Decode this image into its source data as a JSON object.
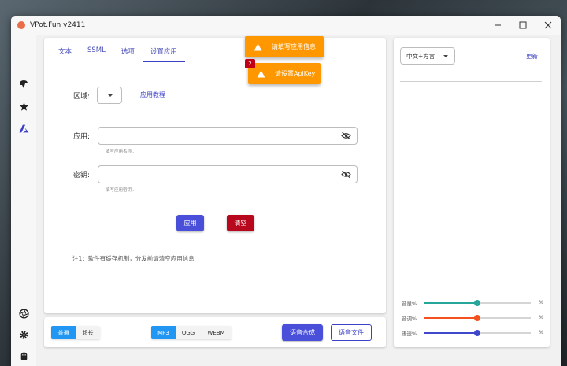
{
  "window": {
    "title": "VPot.Fun v2411"
  },
  "tabs": [
    {
      "label": "文本"
    },
    {
      "label": "SSML"
    },
    {
      "label": "选项"
    },
    {
      "label": "设置应用"
    }
  ],
  "form": {
    "region_label": "区域:",
    "tutorial_link": "应用教程",
    "app_label": "应用:",
    "app_hint": "填写应用名称...",
    "key_label": "密钥:",
    "key_hint": "填写应用密钥...",
    "apply_label": "应用",
    "clear_label": "清空",
    "note": "注1：软件有缓存机制，分发前请清空应用信息"
  },
  "toasts": [
    {
      "message": "请填写应用信息"
    },
    {
      "message": "请设置ApiKey",
      "count": "2"
    }
  ],
  "bottom": {
    "modes": [
      "普通",
      "超长"
    ],
    "formats": [
      "MP3",
      "OGG",
      "WEBM"
    ],
    "synthesize_label": "语音合成",
    "file_label": "语音文件"
  },
  "right": {
    "language": "中文+方言",
    "refresh_label": "更新",
    "sliders": [
      {
        "label": "音量%",
        "value": 50,
        "color": "#26a69a",
        "unit": "%"
      },
      {
        "label": "音调%",
        "value": 50,
        "color": "#f4511e",
        "unit": "%"
      },
      {
        "label": "语速%",
        "value": 50,
        "color": "#3f48cc",
        "unit": "%"
      }
    ]
  },
  "colors": {
    "accent": "#3c40c6",
    "primary": "#4a4fd9",
    "danger": "#b8081e",
    "warning": "#ff9800",
    "toggle": "#2196f3"
  }
}
